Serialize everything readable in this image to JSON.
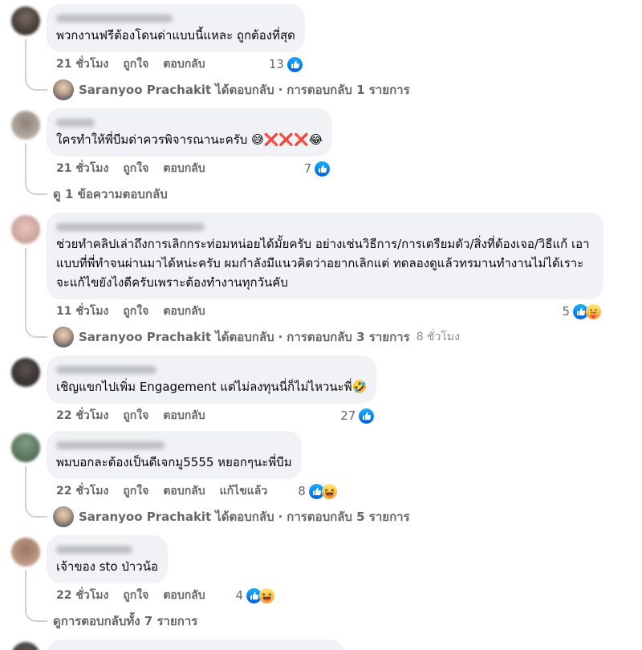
{
  "colors": {
    "bubble": "#f0f2f5",
    "text": "#050505",
    "secondary": "#65676b",
    "muted": "#8a8d91",
    "like_blue": "#1877f2",
    "connector": "#ced0d4"
  },
  "labels": {
    "like": "ถูกใจ",
    "reply": "ตอบกลับ",
    "edited": "แก้ไขแล้ว",
    "replied_verb": "ได้ตอบกลับ",
    "separator": "·"
  },
  "page_author": "Saranyoo Prachakit",
  "comments": [
    {
      "text": "พวกงานฟรีต้องโดนด่าแบบนี้แหละ ถูกต้องที่สุด",
      "time": "21 ชั่วโมง",
      "reaction_count": "13",
      "reactions": [
        "like-icon"
      ],
      "replies": {
        "count_text": "การตอบกลับ 1 รายการ"
      }
    },
    {
      "text": "ใครทำให้พี่บีมด่าควรพิจารณานะครับ 😅❌❌❌😂",
      "time": "21 ชั่วโมง",
      "reaction_count": "7",
      "reactions": [
        "like-icon"
      ],
      "replies": {
        "view_text": "ดู 1 ข้อความตอบกลับ"
      }
    },
    {
      "text": "ช่วยทำคลิปเล่าถึงการเลิกกระท่อมหน่อยได้มั้ยครับ อย่างเช่นวิธีการ/การเตรียมตัว/สิ่งที่ต้องเจอ/วิธีแก้ เอาแบบที่พี่ทำจนผ่านมาได้หน่ะครับ ผมกำลังมีแนวคิดว่าอยากเลิกแต่ ทดลองดูแล้วทรมานทำงานไม่ได้เราะจะแก้ไขยังไงดีครับเพราะต้องทำงานทุกวันคับ",
      "time": "11 ชั่วโมง",
      "reaction_count": "5",
      "reactions": [
        "like-icon",
        "care-icon"
      ],
      "replies": {
        "count_text": "การตอบกลับ 3 รายการ",
        "time": "8 ชั่วโมง"
      }
    },
    {
      "text": "เชิญแขกไปเพิ่ม Engagement แต่ไม่ลงทุนนี่ก็ไม่ไหวนะพี่🤣",
      "time": "22 ชั่วโมง",
      "reaction_count": "27",
      "reactions": [
        "like-icon"
      ]
    },
    {
      "text": "พมบอกละต้องเป็นดีเจกมู5555 หยอกๆนะพี่บีม",
      "time": "22 ชั่วโมง",
      "reaction_count": "8",
      "reactions": [
        "like-icon",
        "haha-icon"
      ],
      "replies": {
        "count_text": "การตอบกลับ 5 รายการ"
      }
    },
    {
      "text": "เจ้าของ sto ป่าวน้อ",
      "time": "22 ชั่วโมง",
      "reaction_count": "4",
      "reactions": [
        "like-icon",
        "haha-icon"
      ],
      "replies": {
        "view_text": "ดูการตอบกลับทั้ง 7 รายการ"
      }
    }
  ]
}
